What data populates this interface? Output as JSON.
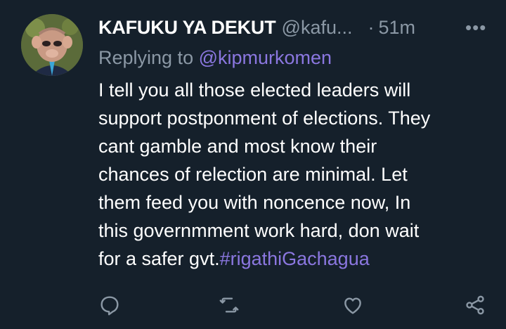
{
  "tweet": {
    "display_name": "KAFUKU YA DEKUT",
    "handle": "@kafu...",
    "separator": "·",
    "time": "51m",
    "more": "•••",
    "replying_prefix": "Replying to ",
    "replying_to": "@kipmurkomen",
    "body_lines": [
      "I tell you all those elected leaders will",
      "support postponment of elections. They",
      "cant gamble and most know their",
      "chances of relection are minimal. Let",
      "them feed you with noncence now, In",
      "this governmment work hard, don wait"
    ],
    "last_line_text": "for a safer gvt.",
    "hashtag": "#rigathiGachagua"
  },
  "actions": {
    "reply_icon": "reply-icon",
    "retweet_icon": "retweet-icon",
    "like_icon": "like-icon",
    "share_icon": "share-icon"
  },
  "colors": {
    "background": "#15202b",
    "secondary_text": "#8b98a5",
    "accent": "#8b77e0"
  }
}
